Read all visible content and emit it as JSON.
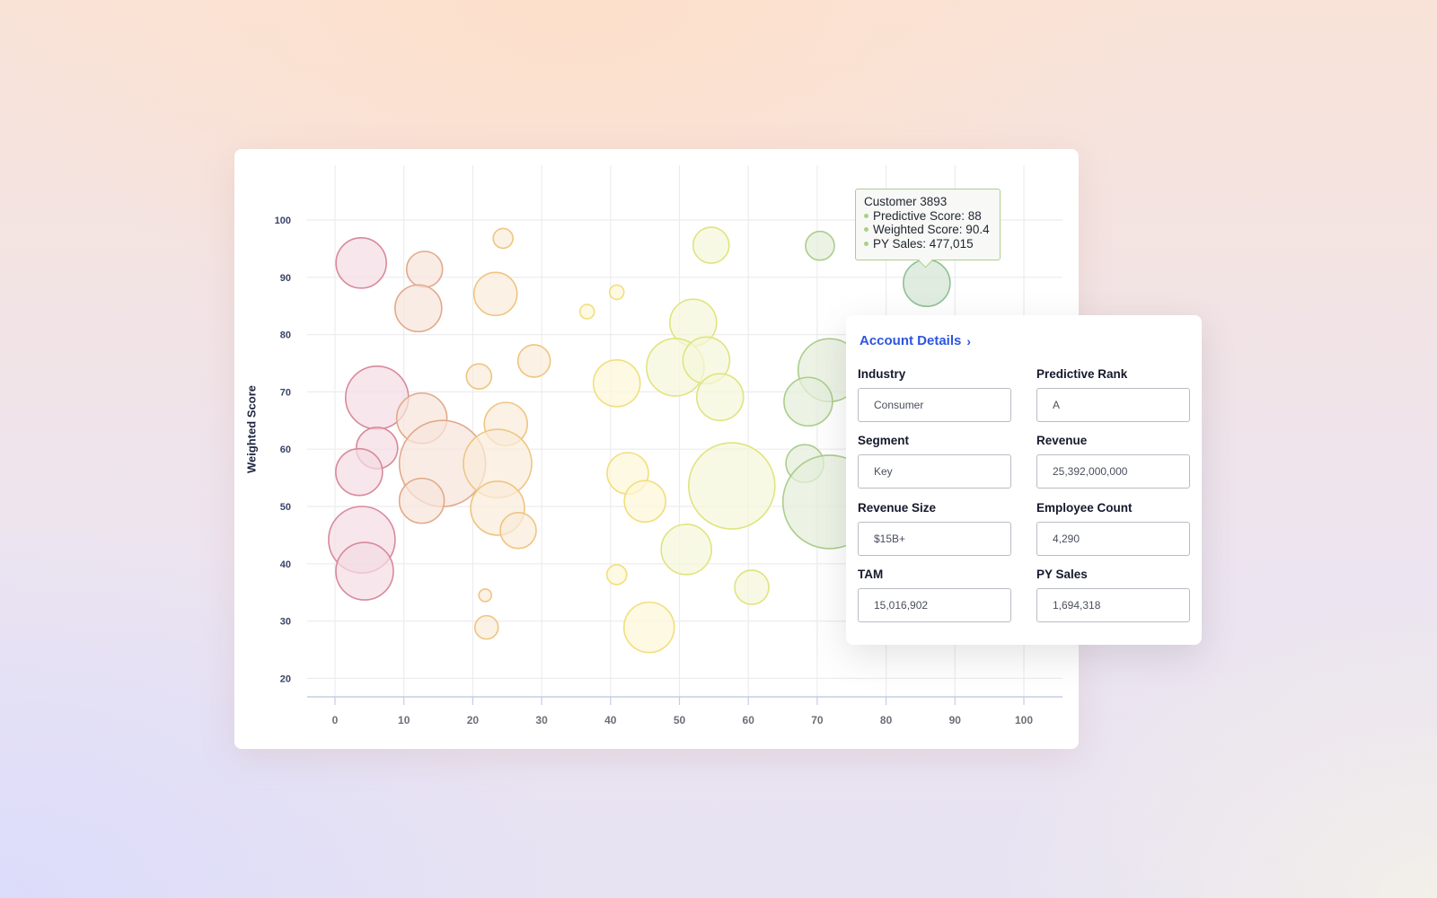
{
  "chart_data": {
    "type": "scatter",
    "subtype": "bubble",
    "title": "",
    "xlabel": "",
    "ylabel": "Weighted Score",
    "xlim": [
      -4,
      106
    ],
    "ylim": [
      16.5,
      109.5
    ],
    "xticks": [
      0,
      10,
      20,
      30,
      40,
      50,
      60,
      70,
      80,
      90,
      100
    ],
    "yticks": [
      20,
      30,
      40,
      50,
      60,
      70,
      80,
      90,
      100
    ],
    "grid": true,
    "legend": "none",
    "series": [
      {
        "name": "pink",
        "color": "#d9899c",
        "fill": "#f4dde3",
        "points": [
          {
            "x": 3.8,
            "y": 92.5,
            "size": 28
          },
          {
            "x": 6.1,
            "y": 69,
            "size": 35
          },
          {
            "x": 6.1,
            "y": 60.2,
            "size": 23
          },
          {
            "x": 3.5,
            "y": 56,
            "size": 26
          },
          {
            "x": 3.9,
            "y": 44.2,
            "size": 37
          },
          {
            "x": 4.3,
            "y": 38.7,
            "size": 32
          }
        ]
      },
      {
        "name": "salmon",
        "color": "#e3a98a",
        "fill": "#f7e4db",
        "points": [
          {
            "x": 13,
            "y": 91.4,
            "size": 20
          },
          {
            "x": 12.1,
            "y": 84.6,
            "size": 26
          },
          {
            "x": 12.6,
            "y": 65.4,
            "size": 28
          },
          {
            "x": 15.6,
            "y": 57.5,
            "size": 48
          },
          {
            "x": 12.6,
            "y": 51,
            "size": 25
          }
        ]
      },
      {
        "name": "orange",
        "color": "#eec580",
        "fill": "#f9ecd9",
        "points": [
          {
            "x": 24.4,
            "y": 96.8,
            "size": 11
          },
          {
            "x": 23.3,
            "y": 87.1,
            "size": 24
          },
          {
            "x": 28.9,
            "y": 75.4,
            "size": 18
          },
          {
            "x": 20.9,
            "y": 72.7,
            "size": 14
          },
          {
            "x": 24.8,
            "y": 64.4,
            "size": 24
          },
          {
            "x": 23.6,
            "y": 57.5,
            "size": 38
          },
          {
            "x": 23.6,
            "y": 49.7,
            "size": 30
          },
          {
            "x": 26.6,
            "y": 45.8,
            "size": 20
          },
          {
            "x": 21.8,
            "y": 34.5,
            "size": 7
          },
          {
            "x": 22,
            "y": 28.9,
            "size": 13
          }
        ]
      },
      {
        "name": "yellow",
        "color": "#f2de7c",
        "fill": "#fdf6d8",
        "points": [
          {
            "x": 36.6,
            "y": 84,
            "size": 8
          },
          {
            "x": 40.9,
            "y": 87.4,
            "size": 8
          },
          {
            "x": 40.9,
            "y": 71.5,
            "size": 26
          },
          {
            "x": 42.5,
            "y": 55.8,
            "size": 23
          },
          {
            "x": 45,
            "y": 50.9,
            "size": 23
          },
          {
            "x": 40.9,
            "y": 38.1,
            "size": 11
          },
          {
            "x": 45.6,
            "y": 28.9,
            "size": 28
          }
        ]
      },
      {
        "name": "yellow-green",
        "color": "#dfe47e",
        "fill": "#f5f7da",
        "points": [
          {
            "x": 54.6,
            "y": 95.6,
            "size": 20
          },
          {
            "x": 52,
            "y": 82.1,
            "size": 26
          },
          {
            "x": 49.4,
            "y": 74.3,
            "size": 32
          },
          {
            "x": 53.9,
            "y": 75.5,
            "size": 26
          },
          {
            "x": 55.9,
            "y": 69.1,
            "size": 26
          },
          {
            "x": 57.6,
            "y": 53.6,
            "size": 48
          },
          {
            "x": 51,
            "y": 42.5,
            "size": 28
          },
          {
            "x": 60.5,
            "y": 35.9,
            "size": 19
          }
        ]
      },
      {
        "name": "green",
        "color": "#abcd8a",
        "fill": "#e5eedb",
        "points": [
          {
            "x": 70.4,
            "y": 95.5,
            "size": 16
          },
          {
            "x": 71.8,
            "y": 73.8,
            "size": 35
          },
          {
            "x": 68.7,
            "y": 68.3,
            "size": 27
          },
          {
            "x": 68.2,
            "y": 57.5,
            "size": 21
          },
          {
            "x": 71.8,
            "y": 50.8,
            "size": 52
          }
        ]
      },
      {
        "name": "selected",
        "color": "#8fc095",
        "fill": "#d3e5d3",
        "points": [
          {
            "x": 85.9,
            "y": 89,
            "size": 26,
            "label": "Customer 3893"
          }
        ]
      }
    ],
    "annotations": [
      {
        "type": "tooltip",
        "target": "Customer 3893",
        "title": "Customer 3893",
        "rows": [
          "Predictive Score: 88",
          "Weighted Score: 90.4",
          "PY Sales: 477,015"
        ]
      }
    ]
  },
  "tooltip": {
    "title": "Customer 3893",
    "rows": [
      "Predictive Score: 88",
      "Weighted Score: 90.4",
      "PY Sales: 477,015"
    ],
    "accent": "#a9d08a"
  },
  "panel": {
    "title": "Account Details",
    "title_icon": "chevron-right-icon",
    "accent": "#2d55e0",
    "fields": [
      {
        "label": "Industry",
        "value": "Consumer"
      },
      {
        "label": "Predictive Rank",
        "value": "A"
      },
      {
        "label": "Segment",
        "value": "Key"
      },
      {
        "label": "Revenue",
        "value": "25,392,000,000"
      },
      {
        "label": "Revenue Size",
        "value": "$15B+"
      },
      {
        "label": "Employee Count",
        "value": "4,290"
      },
      {
        "label": "TAM",
        "value": "15,016,902"
      },
      {
        "label": "PY Sales",
        "value": "1,694,318"
      }
    ]
  }
}
